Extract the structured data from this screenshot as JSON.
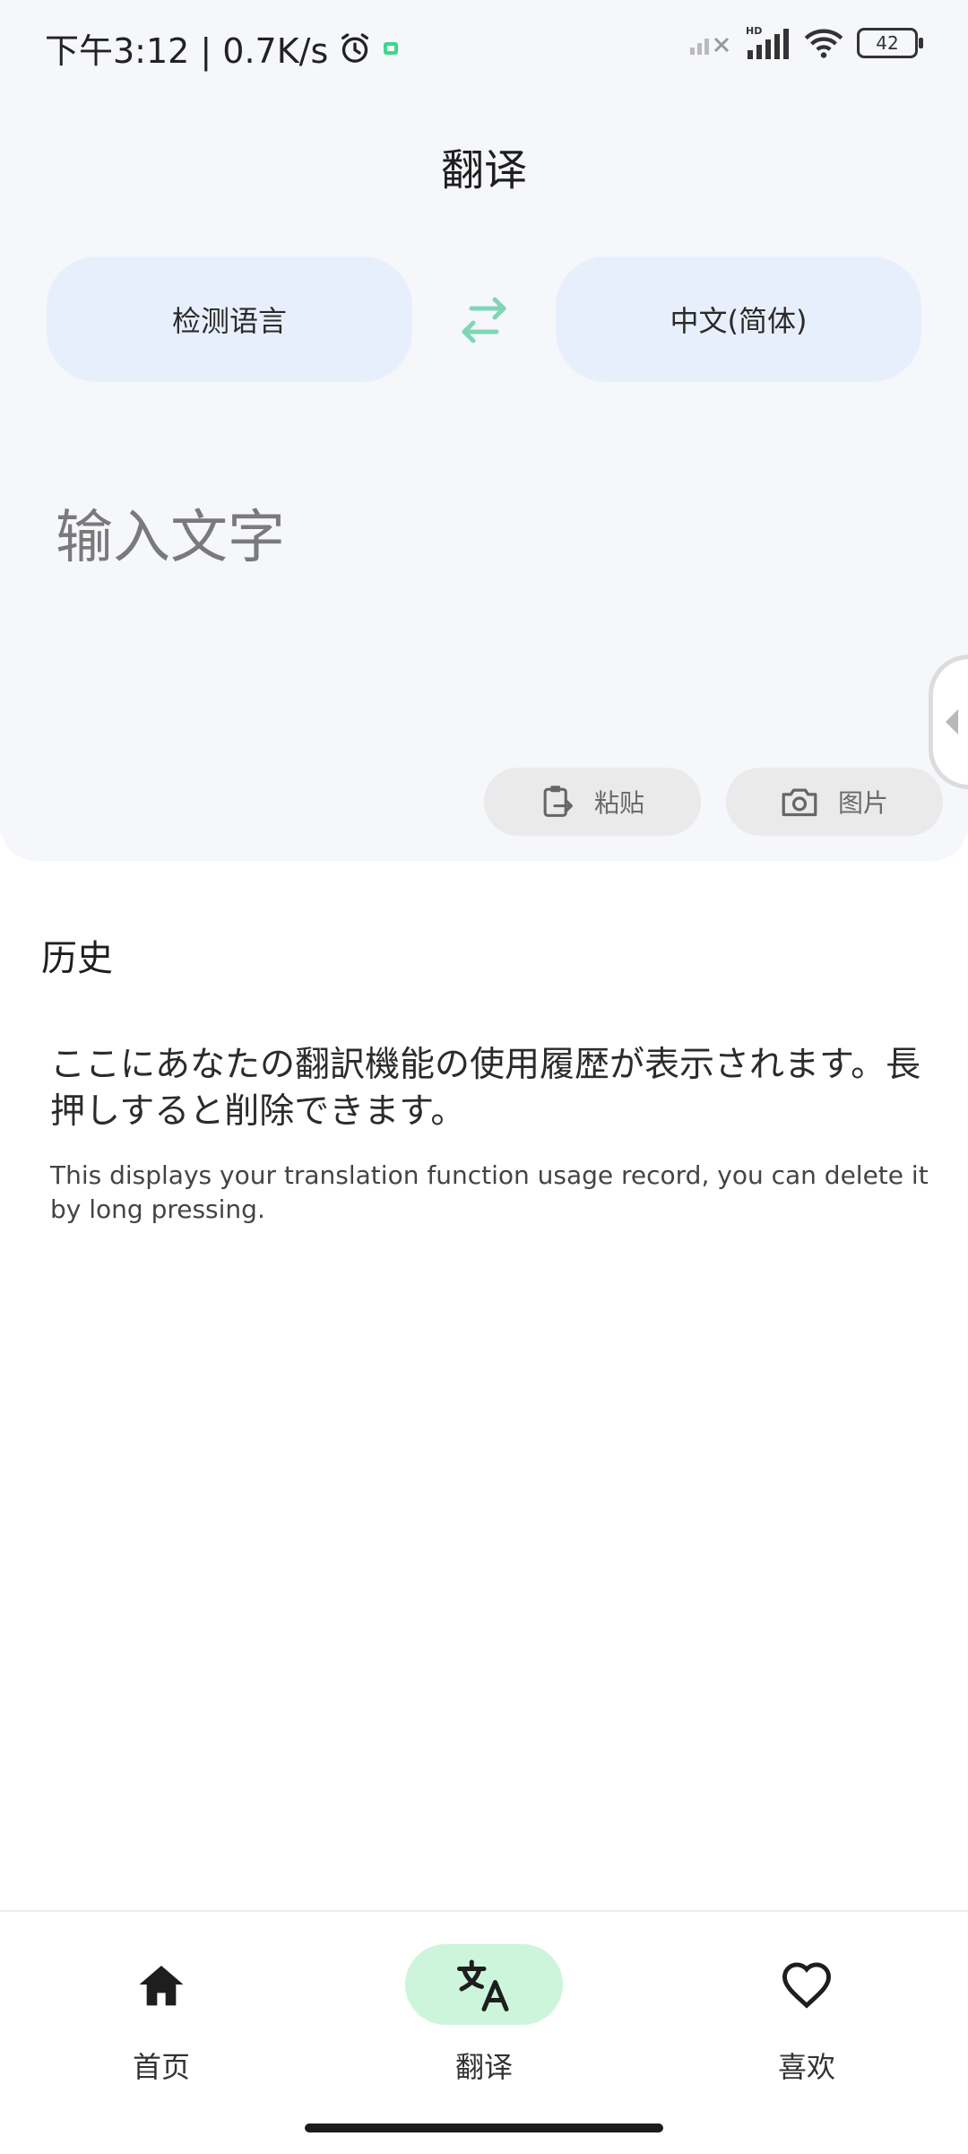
{
  "status_bar": {
    "time_speed": "下午3:12 | 0.7K/s",
    "battery": "42"
  },
  "header": {
    "title": "翻译"
  },
  "languages": {
    "source": "检测语言",
    "target": "中文(简体)"
  },
  "input": {
    "placeholder": "输入文字"
  },
  "actions": {
    "paste": "粘贴",
    "image": "图片"
  },
  "history": {
    "title": "历史",
    "empty_ja": "ここにあなたの翻訳機能の使用履歴が表示されます。長押しすると削除できます。",
    "empty_en": "This displays your translation function usage record, you can delete it by long pressing."
  },
  "nav": {
    "home": "首页",
    "translate": "翻译",
    "favorites": "喜欢"
  },
  "colors": {
    "accent": "#7fd6b5",
    "nav_active_bg": "#cdf5dc",
    "lang_button_bg": "#e8effc"
  }
}
